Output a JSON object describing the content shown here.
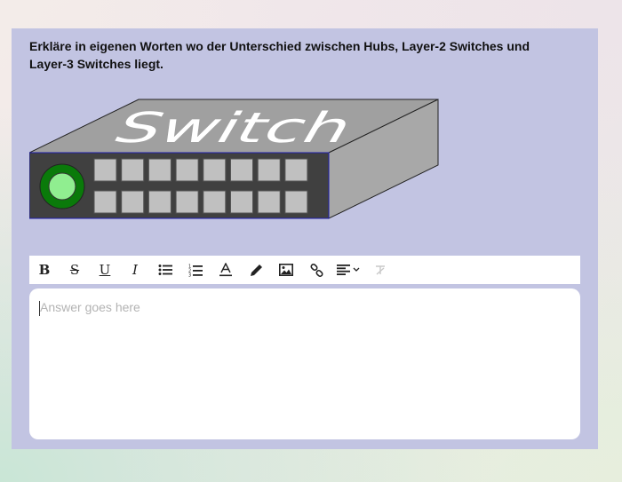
{
  "question": {
    "text": "Erkläre in eigenen Worten wo der Unterschied zwischen Hubs, Layer-2 Switches und Layer-3 Switches liegt."
  },
  "figure": {
    "label": "Switch",
    "led_color": "#90ee90",
    "body_color": "#a0a0a0",
    "front_color": "#404040",
    "port_color": "#c0c0c0",
    "port_rows": 2,
    "ports_per_row": 8
  },
  "toolbar": {
    "buttons": [
      {
        "name": "bold-button",
        "icon": "bold-icon",
        "glyph": "B"
      },
      {
        "name": "strikethrough-button",
        "icon": "strikethrough-icon",
        "glyph": "S"
      },
      {
        "name": "underline-button",
        "icon": "underline-icon",
        "glyph": "U"
      },
      {
        "name": "italic-button",
        "icon": "italic-icon",
        "glyph": "I"
      },
      {
        "name": "bullet-list-button",
        "icon": "bullet-list-icon"
      },
      {
        "name": "numbered-list-button",
        "icon": "numbered-list-icon"
      },
      {
        "name": "text-color-button",
        "icon": "text-color-icon"
      },
      {
        "name": "highlight-button",
        "icon": "pencil-icon"
      },
      {
        "name": "image-button",
        "icon": "image-icon"
      },
      {
        "name": "link-button",
        "icon": "link-icon"
      },
      {
        "name": "align-dropdown-button",
        "icon": "align-left-icon"
      },
      {
        "name": "clear-format-button",
        "icon": "clear-format-icon",
        "disabled": true
      }
    ]
  },
  "answer": {
    "placeholder": "Answer goes here",
    "value": ""
  }
}
